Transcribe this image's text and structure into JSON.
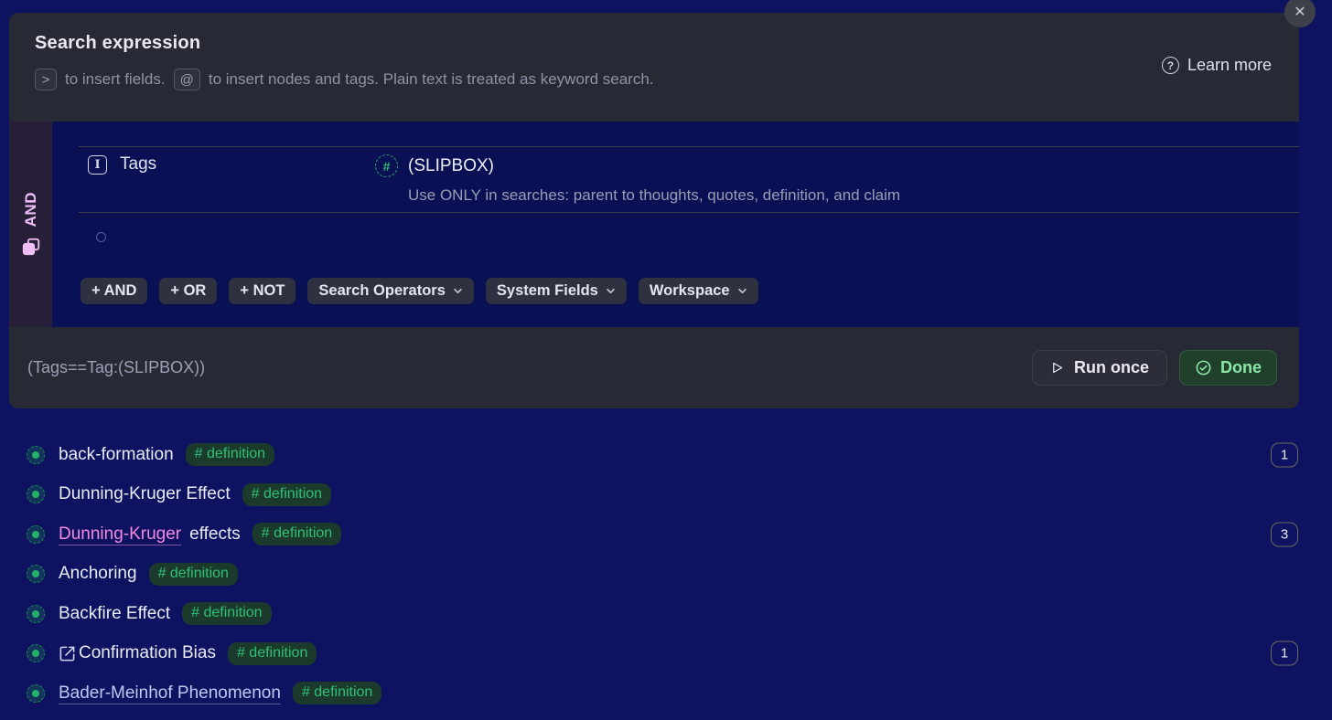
{
  "icons": {
    "close": "✕",
    "help": "?",
    "tag_hash": "#",
    "field": "I"
  },
  "colors": {
    "page_background": "#0d1360",
    "panel_gray": "#272935",
    "query_navy": "#0a1054",
    "and_strip_purple": "#271f37",
    "and_pink": "#f0bdf6",
    "accent_green": "#2fc077",
    "pink_link": "#f18ae0",
    "done_green": "#8ce8a6"
  },
  "modal": {
    "title": "Search expression",
    "learn_more": "Learn more",
    "hint": {
      "key_fields": ">",
      "text_fields": "to insert fields.",
      "key_nodes": "@",
      "text_nodes": "to insert nodes and tags. Plain text is treated as keyword search."
    },
    "group_operator": "AND",
    "field_row": {
      "label": "Tags",
      "value": "(SLIPBOX)",
      "description": "Use ONLY in searches: parent to thoughts, quotes, definition, and claim"
    },
    "builder_buttons": {
      "and": "+ AND",
      "or": "+ OR",
      "not": "+ NOT",
      "search_operators": "Search Operators",
      "system_fields": "System Fields",
      "workspace": "Workspace"
    },
    "footer": {
      "expression": "(Tags==Tag:(SLIPBOX))",
      "run_once": "Run once",
      "done": "Done"
    }
  },
  "results": {
    "badge_label": "# definition",
    "items": [
      {
        "title": "back-formation",
        "count": "1"
      },
      {
        "title": "Dunning-Kruger Effect"
      },
      {
        "link_text": "Dunning-Kruger",
        "rest_text": "effects",
        "count": "3"
      },
      {
        "title": "Anchoring"
      },
      {
        "title": "Backfire Effect"
      },
      {
        "title": "Confirmation Bias",
        "count": "1"
      },
      {
        "title": "Bader-Meinhof Phenomenon"
      }
    ]
  }
}
